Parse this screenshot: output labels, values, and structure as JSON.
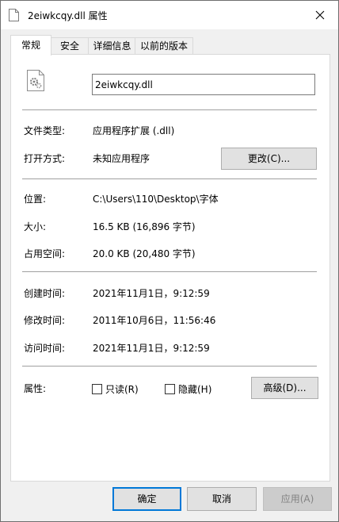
{
  "window": {
    "title": "2eiwkcqy.dll 属性"
  },
  "tabs": [
    "常规",
    "安全",
    "详细信息",
    "以前的版本"
  ],
  "file": {
    "name": "2eiwkcqy.dll"
  },
  "fields": {
    "type_label": "文件类型:",
    "type_value": "应用程序扩展 (.dll)",
    "open_label": "打开方式:",
    "open_value": "未知应用程序",
    "change_button": "更改(C)...",
    "location_label": "位置:",
    "location_value": "C:\\Users\\110\\Desktop\\字体",
    "size_label": "大小:",
    "size_value": "16.5 KB (16,896 字节)",
    "disk_label": "占用空间:",
    "disk_value": "20.0 KB (20,480 字节)",
    "created_label": "创建时间:",
    "created_value": "2021年11月1日，9:12:59",
    "modified_label": "修改时间:",
    "modified_value": "2011年10月6日，11:56:46",
    "accessed_label": "访问时间:",
    "accessed_value": "2021年11月1日，9:12:59",
    "attr_label": "属性:",
    "readonly_label": "只读(R)",
    "readonly_checked": false,
    "hidden_label": "隐藏(H)",
    "hidden_checked": false,
    "advanced_button": "高级(D)..."
  },
  "buttons": {
    "ok": "确定",
    "cancel": "取消",
    "apply": "应用(A)"
  },
  "colors": {
    "focus": "#0078d7",
    "button_face": "#e1e1e1"
  }
}
